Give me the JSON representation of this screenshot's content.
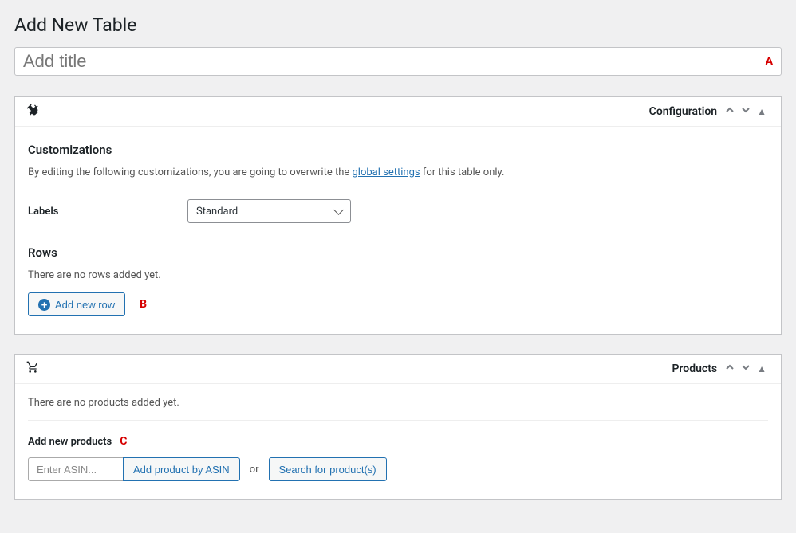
{
  "page_title": "Add New Table",
  "title_placeholder": "Add title",
  "annotations": {
    "a": "A",
    "b": "B",
    "c": "C"
  },
  "config_box": {
    "header": "Configuration",
    "customizations_title": "Customizations",
    "custom_text_before": "By editing the following customizations, you are going to overwrite the ",
    "custom_link": "global settings",
    "custom_text_after": " for this table only.",
    "labels_label": "Labels",
    "labels_value": "Standard",
    "rows_title": "Rows",
    "rows_empty": "There are no rows added yet.",
    "add_row_btn": "Add new row"
  },
  "products_box": {
    "header": "Products",
    "empty": "There are no products added yet.",
    "add_title": "Add new products",
    "asin_placeholder": "Enter ASIN...",
    "add_by_asin_btn": "Add product by ASIN",
    "or_text": "or",
    "search_btn": "Search for product(s)"
  }
}
